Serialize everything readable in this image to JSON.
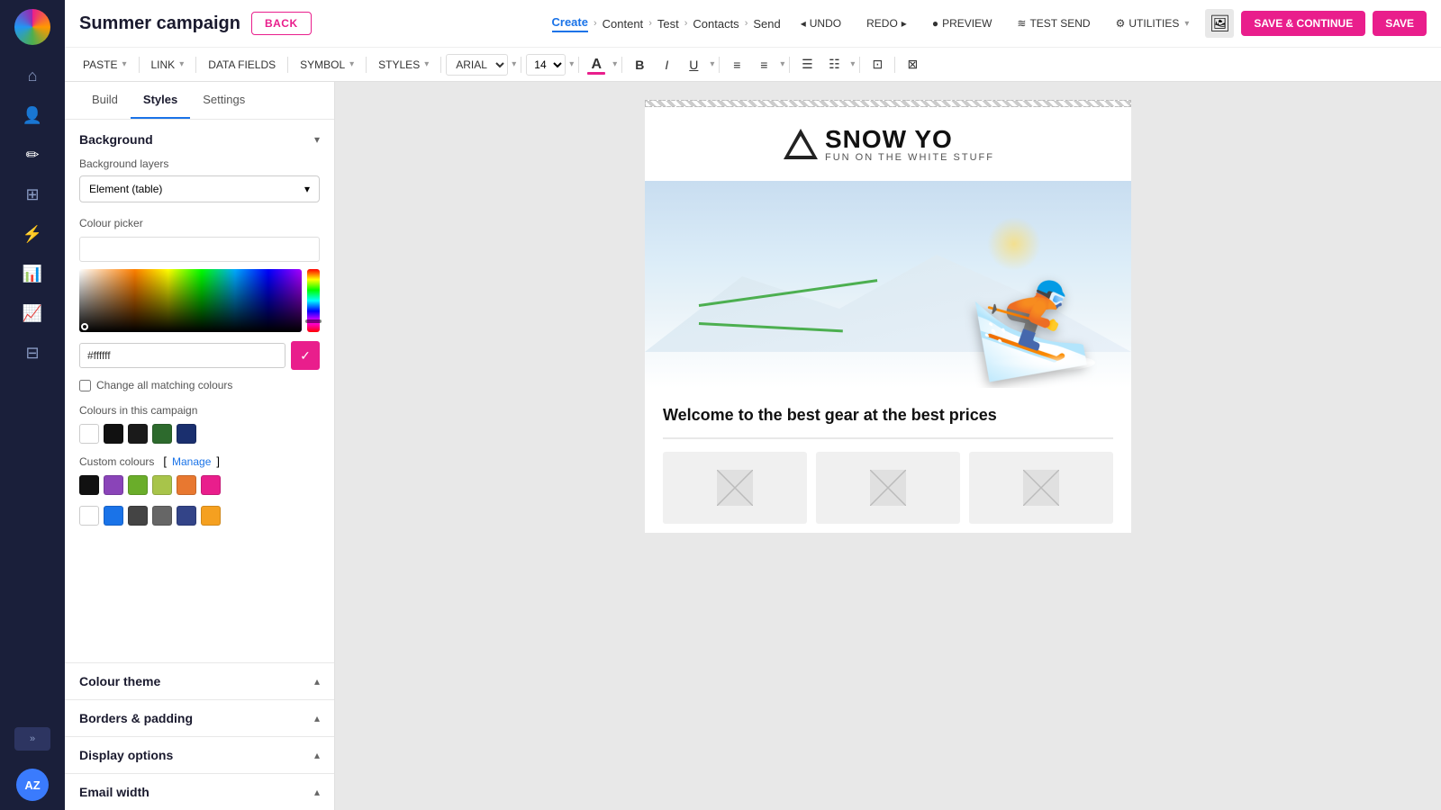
{
  "app": {
    "logo_text": "AZ",
    "title": "Summer campaign"
  },
  "topbar": {
    "back_label": "BACK",
    "breadcrumbs": [
      {
        "label": "Create",
        "active": true
      },
      {
        "label": "Content"
      },
      {
        "label": "Test"
      },
      {
        "label": "Contacts"
      },
      {
        "label": "Send"
      }
    ],
    "undo_label": "UNDO",
    "redo_label": "REDO",
    "preview_label": "PREVIEW",
    "test_send_label": "TEST SEND",
    "utilities_label": "UTILITIES",
    "save_continue_label": "SAVE & CONTINUE",
    "save_label": "SAVE"
  },
  "toolbar": {
    "paste_label": "PASTE",
    "link_label": "LINK",
    "data_fields_label": "DATA FIELDS",
    "symbol_label": "SYMBOL",
    "styles_label": "STYLES",
    "font_value": "ARIAL",
    "font_size_value": "14",
    "bold_label": "B",
    "italic_label": "I",
    "underline_label": "U"
  },
  "panel": {
    "tabs": [
      {
        "label": "Build",
        "active": false
      },
      {
        "label": "Styles",
        "active": true
      },
      {
        "label": "Settings",
        "active": false
      }
    ],
    "sections": {
      "background": {
        "title": "Background",
        "collapsed": false,
        "background_layers_label": "Background layers",
        "background_layers_value": "Element (table)",
        "colour_picker_label": "Colour picker",
        "hex_value": "#ffffff",
        "change_all_label": "Change all matching colours",
        "campaign_colours_label": "Colours in this campaign",
        "campaign_colours": [
          "#fff",
          "#000",
          "#1a1a1a",
          "#2d6a2d",
          "#1a2f6e"
        ],
        "custom_colours_label": "Custom colours",
        "manage_label": "Manage",
        "custom_colours_row1": [
          "#111",
          "#8a44b8",
          "#6aad2a",
          "#a8c44a",
          "#e87830",
          "#e91e8c"
        ],
        "custom_colours_row2": [
          "#eee",
          "#1a73e8",
          "#444",
          "#666",
          "#334488",
          "#f5a020"
        ]
      },
      "colour_theme": {
        "title": "Colour theme",
        "collapsed": false
      },
      "borders_padding": {
        "title": "Borders & padding",
        "collapsed": false
      },
      "display_options": {
        "title": "Display options",
        "collapsed": false
      },
      "email_width": {
        "title": "Email width",
        "collapsed": false
      }
    }
  },
  "email": {
    "logo_brand": "SNOW YO",
    "logo_subtitle": "FUN ON THE WHITE STUFF",
    "hero_alt": "Skier on snow",
    "heading": "Welcome to the best gear at the best prices"
  },
  "nav_icons": [
    {
      "name": "home-icon",
      "symbol": "⌂"
    },
    {
      "name": "user-icon",
      "symbol": "👤"
    },
    {
      "name": "edit-icon",
      "symbol": "✏"
    },
    {
      "name": "grid-icon",
      "symbol": "⊞"
    },
    {
      "name": "lightning-icon",
      "symbol": "⚡"
    },
    {
      "name": "chart-icon",
      "symbol": "📊"
    },
    {
      "name": "analytics-icon",
      "symbol": "📈"
    },
    {
      "name": "table-icon",
      "symbol": "⊟"
    }
  ]
}
